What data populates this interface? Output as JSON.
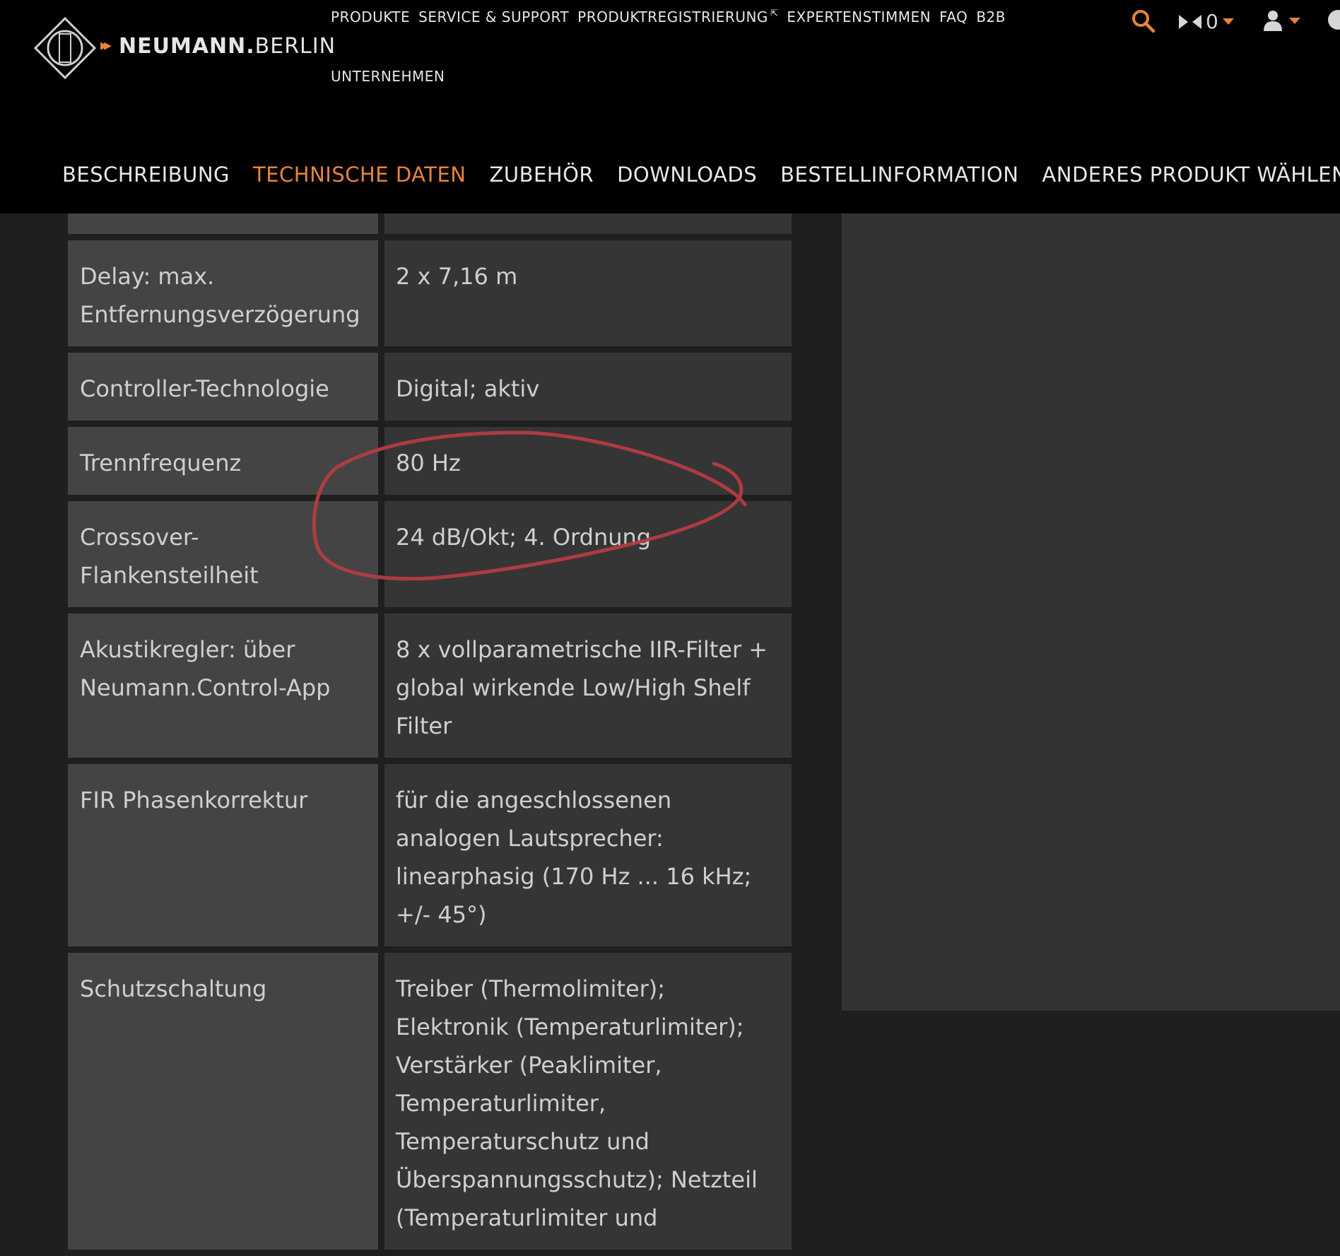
{
  "brand": {
    "name_bold": "NEUMANN.",
    "name_thin": "BERLIN"
  },
  "topnav": {
    "row1": [
      "PRODUKTE",
      "SERVICE & SUPPORT",
      "PRODUKTREGISTRIERUNG",
      "EXPERTENSTIMMEN",
      "FAQ",
      "B2B"
    ],
    "row2": [
      "UNTERNEHMEN"
    ]
  },
  "cart": {
    "count": "0"
  },
  "subnav": {
    "items": [
      "BESCHREIBUNG",
      "TECHNISCHE DATEN",
      "ZUBEHÖR",
      "DOWNLOADS",
      "BESTELLINFORMATION",
      "ANDERES PRODUKT WÄHLEN"
    ],
    "active": "TECHNISCHE DATEN"
  },
  "specs": [
    {
      "label": "Delay: max. Entfernungsverzögerung",
      "value": "2 x 7,16 m"
    },
    {
      "label": "Controller-Technologie",
      "value": "Digital; aktiv"
    },
    {
      "label": "Trennfrequenz",
      "value": "80 Hz"
    },
    {
      "label": "Crossover-Flankensteilheit",
      "value": "24 dB/Okt; 4. Ordnung"
    },
    {
      "label": "Akustikregler: über Neumann.Control-App",
      "value": "8 x vollparametrische IIR-Filter + global wirkende Low/High Shelf Filter"
    },
    {
      "label": "FIR Phasenkorrektur",
      "value": "für die angeschlossenen analogen Lautsprecher: linearphasig (170 Hz ... 16 kHz; +/- 45°)"
    },
    {
      "label": "Schutzschaltung",
      "value": "Treiber (Thermolimiter); Elektronik (Temperaturlimiter); Verstärker (Peaklimiter, Temperaturlimiter, Temperaturschutz und Überspannungsschutz); Netzteil (Temperaturlimiter und"
    }
  ],
  "colors": {
    "accent": "#e8833a",
    "annotation": "#b43c44"
  }
}
